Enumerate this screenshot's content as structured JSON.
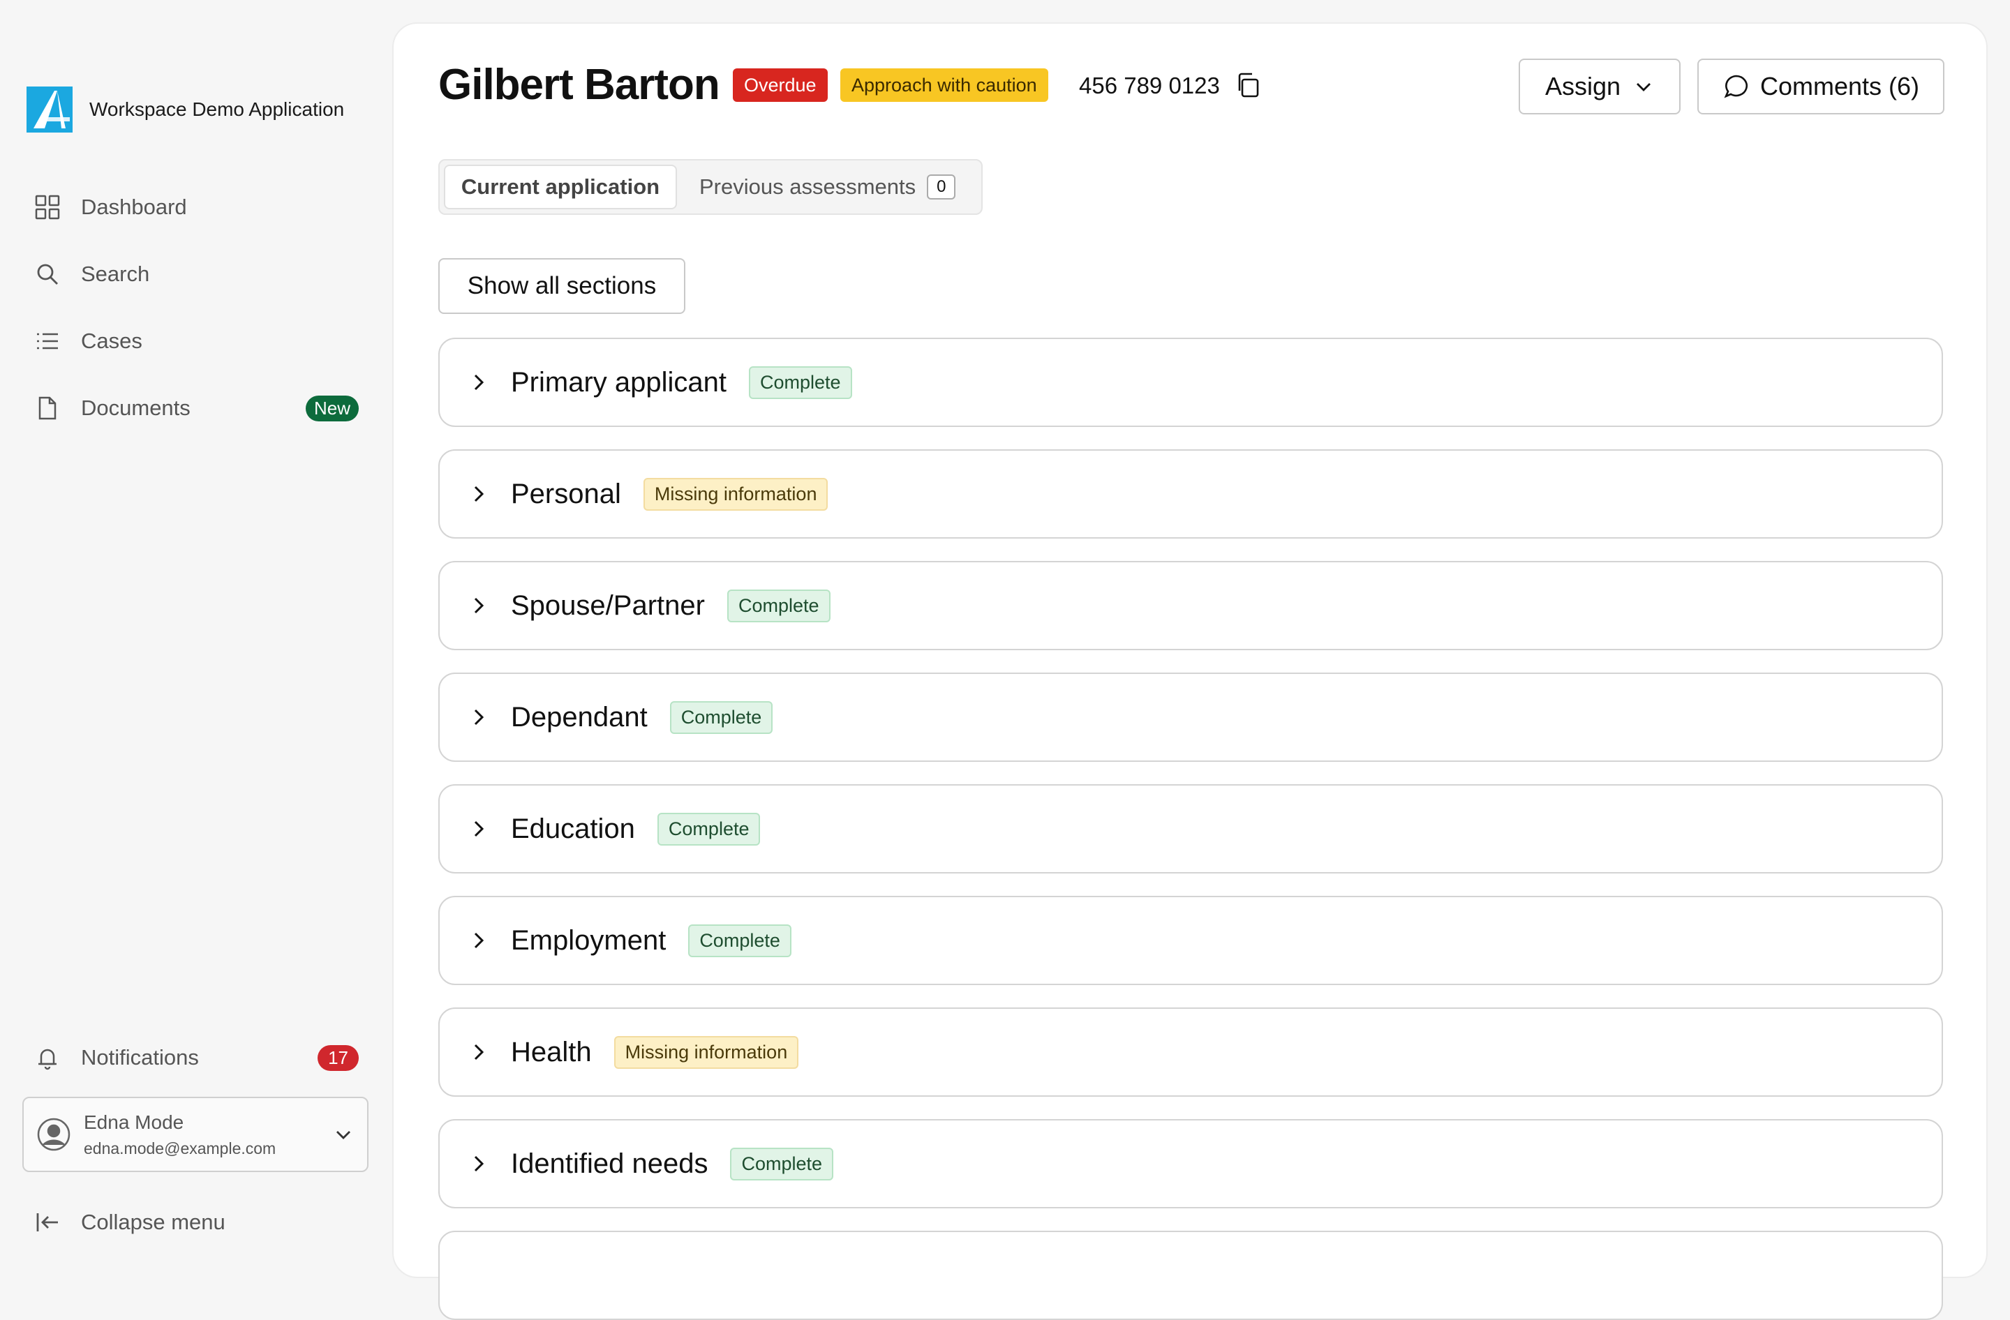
{
  "app": {
    "name": "Workspace Demo Application"
  },
  "sidebar": {
    "items": [
      {
        "label": "Dashboard",
        "icon": "dashboard-grid-icon"
      },
      {
        "label": "Search",
        "icon": "search-icon"
      },
      {
        "label": "Cases",
        "icon": "list-icon"
      },
      {
        "label": "Documents",
        "icon": "document-icon",
        "badge": "New"
      }
    ],
    "notifications": {
      "label": "Notifications",
      "icon": "bell-icon",
      "count": "17"
    },
    "user": {
      "name": "Edna Mode",
      "email": "edna.mode@example.com"
    },
    "collapse_label": "Collapse menu"
  },
  "header": {
    "name": "Gilbert Barton",
    "tags": {
      "overdue": "Overdue",
      "caution": "Approach with caution"
    },
    "phone": "456 789 0123",
    "assign_label": "Assign",
    "comments_label": "Comments (6)"
  },
  "tabs": {
    "current": "Current application",
    "previous": "Previous assessments",
    "previous_count": "0"
  },
  "show_all_label": "Show all sections",
  "sections": [
    {
      "title": "Primary applicant",
      "status": "Complete",
      "kind": "complete"
    },
    {
      "title": "Personal",
      "status": "Missing information",
      "kind": "missing"
    },
    {
      "title": "Spouse/Partner",
      "status": "Complete",
      "kind": "complete"
    },
    {
      "title": "Dependant",
      "status": "Complete",
      "kind": "complete"
    },
    {
      "title": "Education",
      "status": "Complete",
      "kind": "complete"
    },
    {
      "title": "Employment",
      "status": "Complete",
      "kind": "complete"
    },
    {
      "title": "Health",
      "status": "Missing information",
      "kind": "missing"
    },
    {
      "title": "Identified needs",
      "status": "Complete",
      "kind": "complete"
    }
  ],
  "colors": {
    "overdue": "#d8261f",
    "caution": "#f8c623",
    "new_badge": "#0d6b3c",
    "count_badge": "#d0272d",
    "complete_bg": "#e1f4e7",
    "missing_bg": "#fdf0c6",
    "brand": "#1ba8e0"
  }
}
